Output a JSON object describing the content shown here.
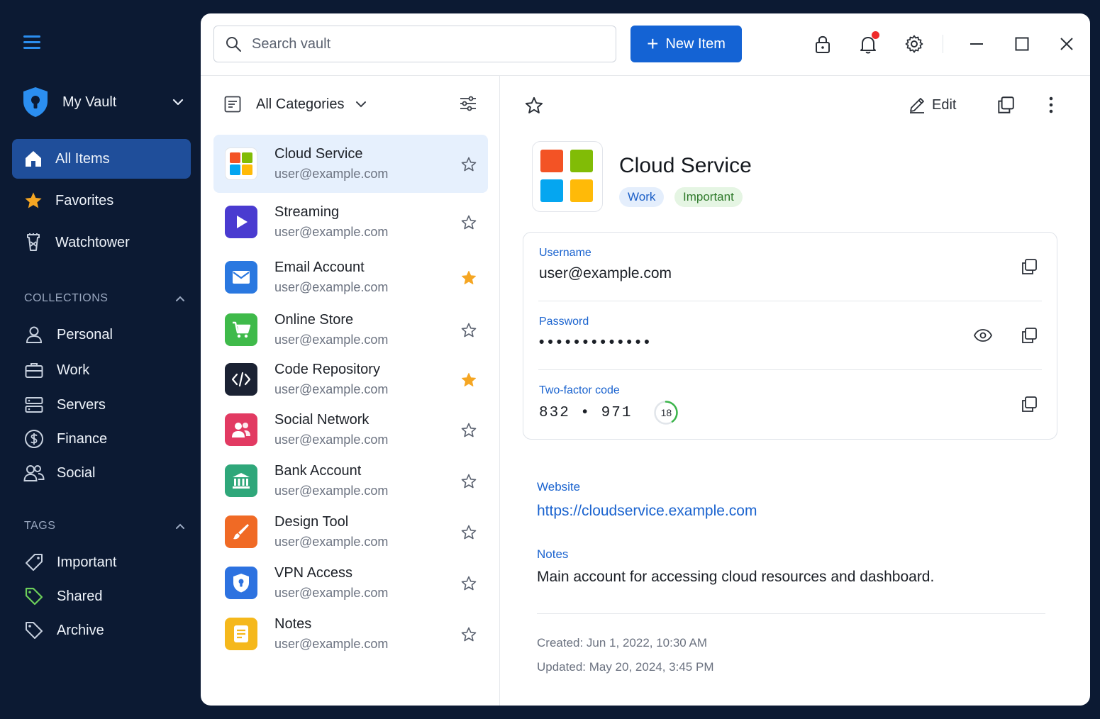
{
  "sidebar": {
    "vault_name": "My Vault",
    "nav": [
      {
        "label": "All Items",
        "icon": "home-icon",
        "active": true
      },
      {
        "label": "Favorites",
        "icon": "star-icon"
      },
      {
        "label": "Watchtower",
        "icon": "watchtower-icon"
      }
    ],
    "collections_heading": "COLLECTIONS",
    "collections": [
      {
        "label": "Personal",
        "icon": "user-icon"
      },
      {
        "label": "Work",
        "icon": "briefcase-icon"
      },
      {
        "label": "Servers",
        "icon": "server-icon"
      },
      {
        "label": "Finance",
        "icon": "dollar-icon"
      },
      {
        "label": "Social",
        "icon": "users-icon"
      }
    ],
    "tags_heading": "TAGS",
    "tags": [
      {
        "label": "Important",
        "icon": "tag-icon",
        "color": "#c7d0de"
      },
      {
        "label": "Shared",
        "icon": "tag-icon",
        "color": "#6ccf5a"
      },
      {
        "label": "Archive",
        "icon": "tag-icon",
        "color": "#c7d0de"
      }
    ]
  },
  "toolbar": {
    "search_placeholder": "Search vault",
    "new_item_label": "New Item"
  },
  "list": {
    "category_label": "All Categories",
    "items": [
      {
        "title": "Cloud Service",
        "subtitle": "user@example.com",
        "favorite": false,
        "selected": true,
        "icon": "windows-icon"
      },
      {
        "title": "Streaming",
        "subtitle": "user@example.com",
        "favorite": false,
        "icon": "play-icon",
        "color": "#4a3bd0"
      },
      {
        "title": "Email Account",
        "subtitle": "user@example.com",
        "favorite": true,
        "icon": "mail-icon",
        "color": "#2a78e0"
      },
      {
        "title": "Online Store",
        "subtitle": "user@example.com",
        "favorite": false,
        "icon": "cart-icon",
        "color": "#3fba4a"
      },
      {
        "title": "Code Repository",
        "subtitle": "user@example.com",
        "favorite": true,
        "icon": "code-icon",
        "color": "#1b2233"
      },
      {
        "title": "Social Network",
        "subtitle": "user@example.com",
        "favorite": false,
        "icon": "people-icon",
        "color": "#e23a62"
      },
      {
        "title": "Bank Account",
        "subtitle": "user@example.com",
        "favorite": false,
        "icon": "bank-icon",
        "color": "#2fa77a"
      },
      {
        "title": "Design Tool",
        "subtitle": "user@example.com",
        "favorite": false,
        "icon": "brush-icon",
        "color": "#f06a25"
      },
      {
        "title": "VPN Access",
        "subtitle": "user@example.com",
        "favorite": false,
        "icon": "shield-icon",
        "color": "#2d72e0"
      },
      {
        "title": "Notes",
        "subtitle": "user@example.com",
        "favorite": false,
        "icon": "note-icon",
        "color": "#f5b81c"
      }
    ]
  },
  "detail": {
    "edit_label": "Edit",
    "title": "Cloud Service",
    "tags": [
      "Work",
      "Important"
    ],
    "username_label": "Username",
    "username": "user@example.com",
    "password_label": "Password",
    "password_mask": "•••••••••••••",
    "totp_label": "Two-factor code",
    "totp_code": "832 • 971",
    "totp_seconds": "18",
    "website_label": "Website",
    "website": "https://cloudservice.example.com",
    "notes_label": "Notes",
    "notes": "Main account for accessing cloud resources and dashboard.",
    "created": "Created: Jun 1, 2022, 10:30 AM",
    "updated": "Updated: May 20, 2024, 3:45 PM"
  },
  "colors": {
    "accent": "#1463d4",
    "sidebar_bg": "#0c1a33",
    "favorite": "#f5a623"
  }
}
